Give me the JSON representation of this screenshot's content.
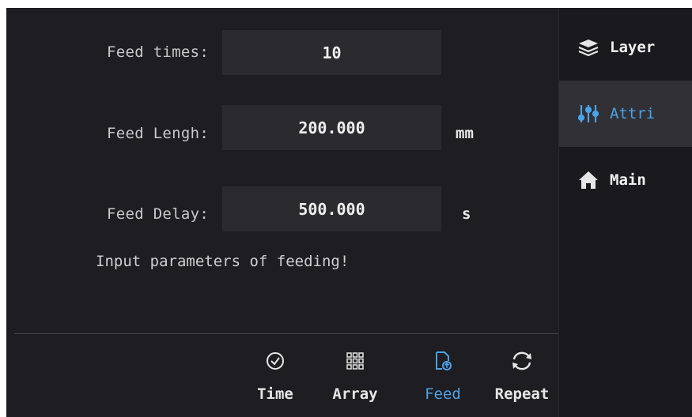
{
  "form": {
    "feed_times": {
      "label": "Feed times:",
      "value": "10",
      "unit": ""
    },
    "feed_length": {
      "label": "Feed Lengh:",
      "value": "200.000",
      "unit": "mm"
    },
    "feed_delay": {
      "label": "Feed Delay:",
      "value": "500.000",
      "unit": "s"
    },
    "hint": "Input parameters of feeding!"
  },
  "bottom_tabs": [
    {
      "label": "Time",
      "icon": "clock-icon",
      "active": false
    },
    {
      "label": "Array",
      "icon": "grid-icon",
      "active": false
    },
    {
      "label": "Feed",
      "icon": "feed-document-icon",
      "active": true
    },
    {
      "label": "Repeat",
      "icon": "repeat-icon",
      "active": false
    }
  ],
  "sidebar": {
    "items": [
      {
        "label": "Layer",
        "icon": "layers-icon",
        "active": false
      },
      {
        "label": "Attri",
        "icon": "sliders-icon",
        "active": true
      },
      {
        "label": "Main",
        "icon": "home-icon",
        "active": false
      }
    ]
  },
  "colors": {
    "background": "#1e1d21",
    "input_background": "#2b2a2e",
    "accent": "#4aa3e8",
    "text": "#e6e6e6"
  }
}
